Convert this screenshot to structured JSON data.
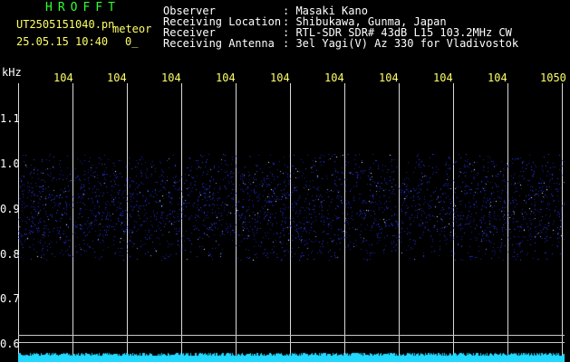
{
  "header": {
    "brand": "HROFFT",
    "filename": "UT2505151040.pn",
    "mode": "meteor",
    "datetime": "25.05.15 10:40",
    "count": "0_"
  },
  "info": [
    {
      "label": "Observer",
      "value": ": Masaki Kano"
    },
    {
      "label": "Receiving Location",
      "value": ": Shibukawa, Gunma, Japan"
    },
    {
      "label": "Receiver",
      "value": ": RTL-SDR SDR# 43dB L15 103.2MHz CW"
    },
    {
      "label": "Receiving Antenna",
      "value": ": 3el Yagi(V) Az 330 for Vladivostok"
    }
  ],
  "axis": {
    "unit": "kHz",
    "x_ticks": [
      "104",
      "104",
      "104",
      "104",
      "104",
      "104",
      "104",
      "104",
      "104",
      "1050"
    ],
    "y_ticks": [
      "1.1",
      "1.0",
      "0.9",
      "0.8",
      "0.7",
      "0.6"
    ]
  },
  "colors": {
    "background": "#000000",
    "brand": "#33ff33",
    "ticks": "#ffff66",
    "noise": "#2a3cff",
    "strip": "#22d8ff"
  }
}
